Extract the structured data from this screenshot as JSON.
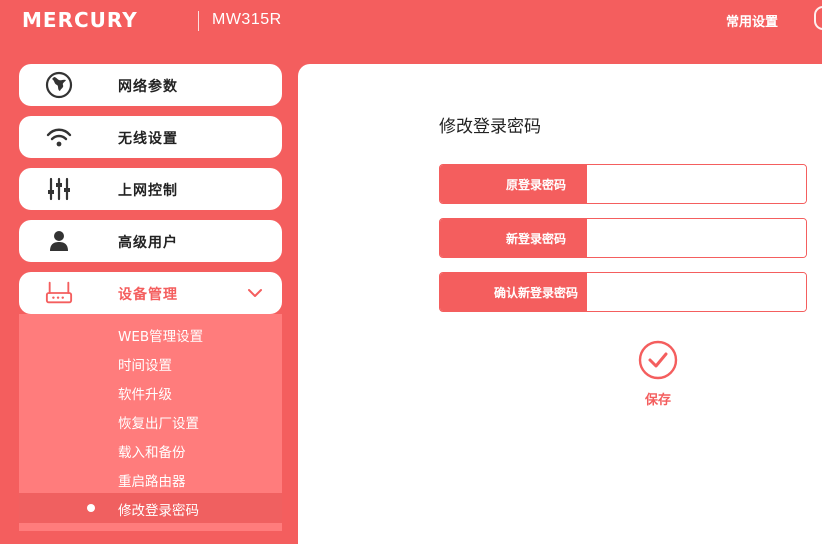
{
  "header": {
    "brand": "MERCURY",
    "model": "MW315R",
    "common_settings": "常用设置"
  },
  "sidebar": {
    "items": [
      {
        "label": "网络参数",
        "icon": "globe-icon"
      },
      {
        "label": "无线设置",
        "icon": "wifi-icon"
      },
      {
        "label": "上网控制",
        "icon": "sliders-icon"
      },
      {
        "label": "高级用户",
        "icon": "user-icon"
      },
      {
        "label": "设备管理",
        "icon": "router-icon",
        "expanded": true
      }
    ],
    "submenu": [
      "WEB管理设置",
      "时间设置",
      "软件升级",
      "恢复出厂设置",
      "载入和备份",
      "重启路由器",
      "修改登录密码"
    ],
    "active_submenu_index": 6
  },
  "main": {
    "title": "修改登录密码",
    "fields": [
      {
        "label": "原登录密码",
        "value": ""
      },
      {
        "label": "新登录密码",
        "value": ""
      },
      {
        "label": "确认新登录密码",
        "value": ""
      }
    ],
    "save_label": "保存"
  },
  "colors": {
    "accent": "#f45e5e",
    "submenu_bg": "#ff7c7c"
  }
}
